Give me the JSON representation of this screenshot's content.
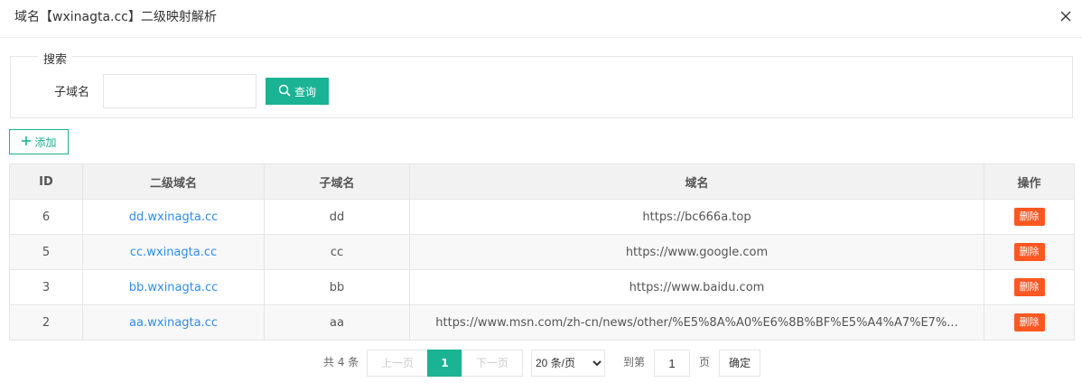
{
  "dialog": {
    "title": "域名【wxinagta.cc】二级映射解析",
    "close_icon": "close-icon"
  },
  "search": {
    "legend": "搜索",
    "subdomain_label": "子域名",
    "subdomain_value": "",
    "search_button": "查询",
    "search_icon": "search-icon"
  },
  "toolbar": {
    "add_button": "添加",
    "add_icon": "plus-icon"
  },
  "table": {
    "headers": [
      "ID",
      "二级域名",
      "子域名",
      "域名",
      "操作"
    ],
    "rows": [
      {
        "id": "6",
        "full": "dd.wxinagta.cc",
        "sub": "dd",
        "target": "https://bc666a.top",
        "action": "删除"
      },
      {
        "id": "5",
        "full": "cc.wxinagta.cc",
        "sub": "cc",
        "target": "https://www.google.com",
        "action": "删除"
      },
      {
        "id": "3",
        "full": "bb.wxinagta.cc",
        "sub": "bb",
        "target": "https://www.baidu.com",
        "action": "删除"
      },
      {
        "id": "2",
        "full": "aa.wxinagta.cc",
        "sub": "aa",
        "target": "https://www.msn.com/zh-cn/news/other/%E5%8A%A0%E6%8B%BF%E5%A4%A7%E7%...",
        "action": "删除"
      }
    ]
  },
  "pagination": {
    "total": "共 4 条",
    "prev": "上一页",
    "current": "1",
    "next": "下一页",
    "limit_selected": "20 条/页",
    "goto_label": "到第",
    "goto_value": "1",
    "page_label": "页",
    "confirm": "确定"
  },
  "colors": {
    "primary": "#1ab394",
    "danger": "#ff5722",
    "link": "#2e8ded"
  }
}
